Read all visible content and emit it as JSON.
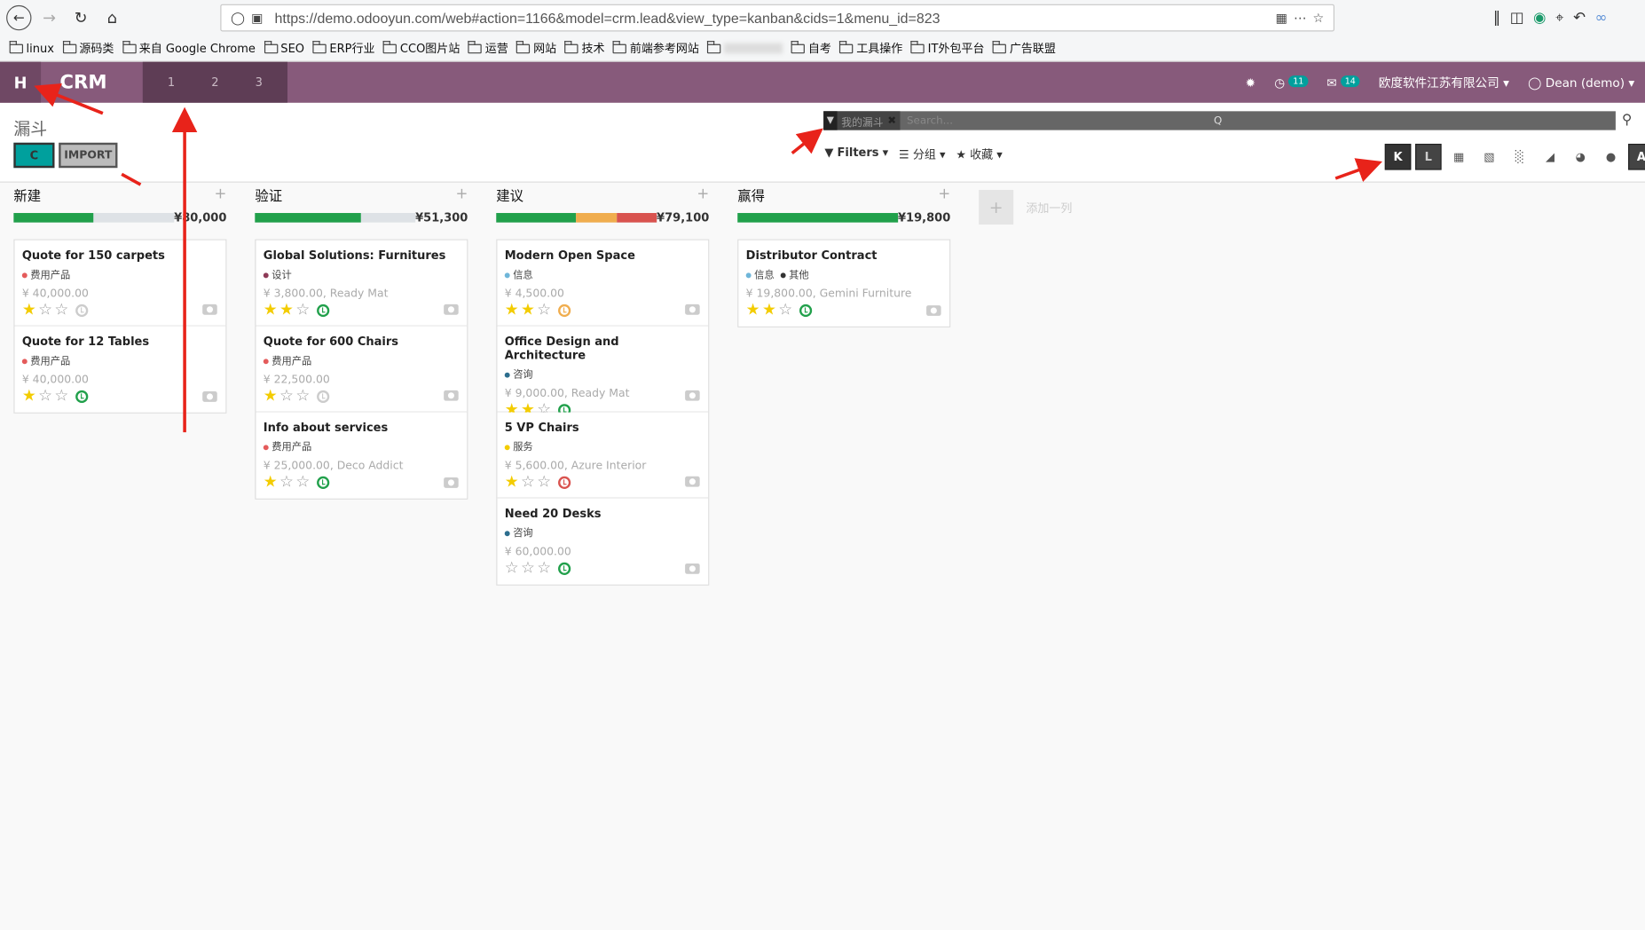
{
  "browser": {
    "url": "https://demo.odooyun.com/web#action=1166&model=crm.lead&view_type=kanban&cids=1&menu_id=823",
    "bookmarks": [
      "linux",
      "源码类",
      "来自 Google Chrome",
      "SEO",
      "ERP行业",
      "CCO图片站",
      "运营",
      "网站",
      "技术",
      "前端参考网站",
      "",
      "自考",
      "工具操作",
      "IT外包平台",
      "广告联盟"
    ]
  },
  "appbar": {
    "switcher": "H",
    "brand": "CRM",
    "menus": [
      "1",
      "2",
      "3"
    ],
    "activity_count": "11",
    "message_count": "14",
    "company": "欧度软件江苏有限公司",
    "user": "Dean (demo)"
  },
  "control": {
    "title": "漏斗",
    "create_label": "C",
    "import_label": "IMPORT",
    "facet_label": "我的漏斗",
    "search_placeholder": "Search...",
    "search_hint": "Q",
    "filters_label": "Filters",
    "groupby_label": "分组",
    "favorites_label": "收藏",
    "view_kanban": "K",
    "view_list": "L",
    "view_activity": "A",
    "add_column_label": "添加一列"
  },
  "colors": {
    "brand": "#875a7b",
    "won": "#21a04b",
    "warn": "#f0ad4e",
    "danger": "#d9534f",
    "accent": "#00a09d"
  },
  "columns": [
    {
      "title": "新建",
      "total": "¥80,000",
      "progress": [
        {
          "value": 0.5,
          "color": "#21a04b"
        }
      ],
      "cards": [
        {
          "title": "Quote for 150 carpets",
          "tags": [
            {
              "label": "费用产品",
              "color": "#e45b5b"
            }
          ],
          "meta": "¥ 40,000.00",
          "stars": 1,
          "activity": "#ccc"
        },
        {
          "title": "Quote for 12 Tables",
          "tags": [
            {
              "label": "费用产品",
              "color": "#e45b5b"
            }
          ],
          "meta": "¥ 40,000.00",
          "stars": 1,
          "activity": "#21a04b"
        }
      ]
    },
    {
      "title": "验证",
      "total": "¥51,300",
      "progress": [
        {
          "value": 0.66,
          "color": "#21a04b"
        }
      ],
      "cards": [
        {
          "title": "Global Solutions: Furnitures",
          "tags": [
            {
              "label": "设计",
              "color": "#8e3b57"
            }
          ],
          "meta": "¥ 3,800.00, Ready Mat",
          "stars": 2,
          "activity": "#21a04b"
        },
        {
          "title": "Quote for 600 Chairs",
          "tags": [
            {
              "label": "费用产品",
              "color": "#e45b5b"
            }
          ],
          "meta": "¥ 22,500.00",
          "stars": 1,
          "activity": "#ccc"
        },
        {
          "title": "Info about services",
          "tags": [
            {
              "label": "费用产品",
              "color": "#e45b5b"
            }
          ],
          "meta": "¥ 25,000.00, Deco Addict",
          "stars": 1,
          "activity": "#21a04b"
        }
      ]
    },
    {
      "title": "建议",
      "total": "¥79,100",
      "progress": [
        {
          "value": 0.5,
          "color": "#21a04b"
        },
        {
          "value": 0.25,
          "color": "#f0ad4e"
        },
        {
          "value": 0.25,
          "color": "#d9534f"
        }
      ],
      "cards": [
        {
          "title": "Modern Open Space",
          "tags": [
            {
              "label": "信息",
              "color": "#6fb6d9"
            }
          ],
          "meta": "¥ 4,500.00",
          "stars": 2,
          "activity": "#f0ad4e"
        },
        {
          "title": "Office Design and Architecture",
          "tags": [
            {
              "label": "咨询",
              "color": "#2d6e8e"
            }
          ],
          "meta": "¥ 9,000.00, Ready Mat",
          "stars": 2,
          "activity": "#21a04b"
        },
        {
          "title": "5 VP Chairs",
          "tags": [
            {
              "label": "服务",
              "color": "#f3cc00"
            }
          ],
          "meta": "¥ 5,600.00, Azure Interior",
          "stars": 1,
          "activity": "#d9534f"
        },
        {
          "title": "Need 20 Desks",
          "tags": [
            {
              "label": "咨询",
              "color": "#2d6e8e"
            }
          ],
          "meta": "¥ 60,000.00",
          "stars": 0,
          "activity": "#21a04b"
        }
      ]
    },
    {
      "title": "赢得",
      "total": "¥19,800",
      "progress": [
        {
          "value": 1.0,
          "color": "#21a04b"
        }
      ],
      "cards": [
        {
          "title": "Distributor Contract",
          "tags": [
            {
              "label": "信息",
              "color": "#6fb6d9"
            },
            {
              "label": "其他",
              "color": "#333"
            }
          ],
          "meta": "¥ 19,800.00, Gemini Furniture",
          "stars": 2,
          "activity": "#21a04b"
        }
      ]
    }
  ]
}
